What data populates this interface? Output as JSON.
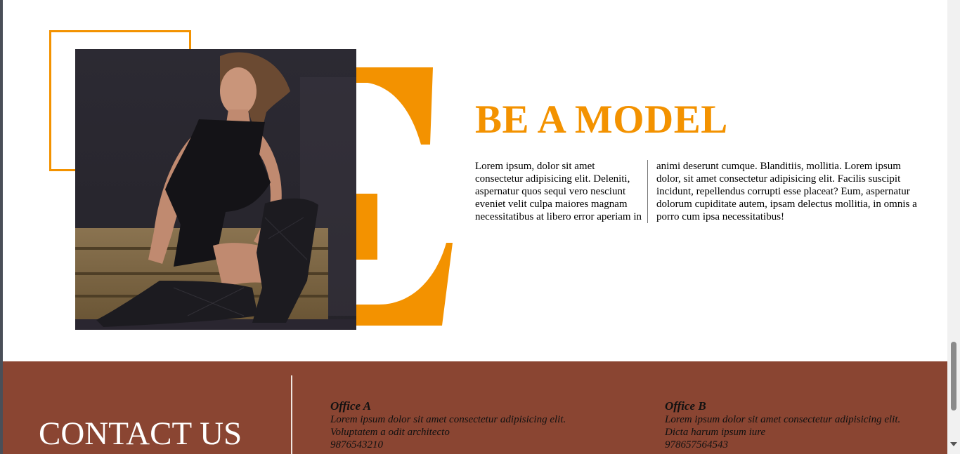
{
  "colors": {
    "accent": "#f39200",
    "footer_bg": "#8a4532",
    "text": "#000000"
  },
  "model_section": {
    "title": "BE A MODEL",
    "photo_icon": "model-photo",
    "paragraph_col1": "Lorem ipsum, dolor sit amet consectetur adipisicing elit. Deleniti, aspernatur quos sequi vero nesciunt eveniet velit culpa maiores magnam necessitatibus at libero error aperiam in",
    "paragraph_col2": "animi deserunt cumque. Blanditiis, mollitia. Lorem ipsum dolor, sit amet consectetur adipisicing elit. Facilis suscipit incidunt, repellendus corrupti esse placeat? Eum, aspernatur dolorum cupiditate autem, ipsam delectus mollitia, in omnis a porro cum ipsa necessitatibus!"
  },
  "contact": {
    "title": "CONTACT US",
    "offices": [
      {
        "name": "Office A",
        "address": "Lorem ipsum dolor sit amet consectetur adipisicing elit. Voluptatem a odit architecto",
        "phone": "9876543210"
      },
      {
        "name": "Office B",
        "address": "Lorem ipsum dolor sit amet consectetur adipisicing elit. Dicta harum ipsum iure",
        "phone": "978657564543"
      }
    ]
  },
  "scrollbar": {
    "position": 0.75
  }
}
